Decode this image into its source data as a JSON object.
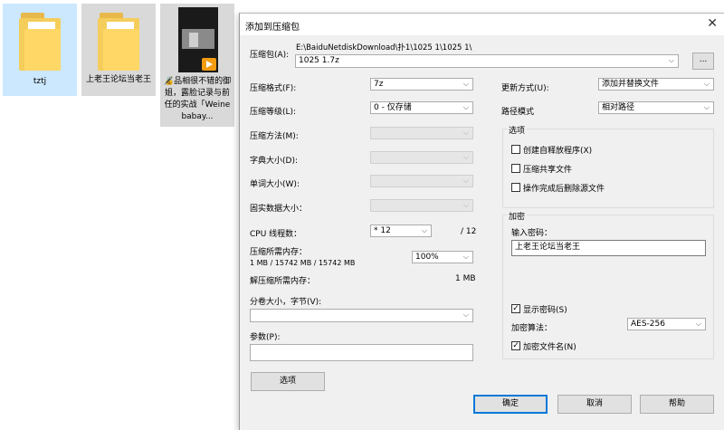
{
  "desktop": {
    "items": [
      {
        "label": "tztj"
      },
      {
        "label": "上老王论坛当老王"
      },
      {
        "label": "🔏品相很不错的御姐，露脸记录与前任的实战「Weine babay..."
      }
    ]
  },
  "dialog": {
    "title": "添加到压缩包",
    "archive_label": "压缩包(A):",
    "archive_path": "E:\\BaiduNetdiskDownload\\扑1\\1025 1\\1025 1\\",
    "archive_name": "1025 1.7z",
    "browse_label": "...",
    "format_label": "压缩格式(F):",
    "format_value": "7z",
    "level_label": "压缩等级(L):",
    "level_value": "0 - 仅存储",
    "method_label": "压缩方法(M):",
    "dict_label": "字典大小(D):",
    "word_label": "单词大小(W):",
    "solid_label": "固实数据大小：",
    "cpu_label": "CPU 线程数：",
    "cpu_value": "* 12",
    "cpu_max": "/ 12",
    "mem_compress_label": "压缩所需内存：",
    "mem_compress_detail": "1 MB / 15742 MB / 15742 MB",
    "mem_percent": "100%",
    "mem_decompress_label": "解压缩所需内存：",
    "mem_decompress_value": "1 MB",
    "split_label": "分卷大小，字节(V):",
    "params_label": "参数(P):",
    "options_button": "选项",
    "update_label": "更新方式(U):",
    "update_value": "添加并替换文件",
    "path_label": "路径模式",
    "path_value": "相对路径",
    "options_group": "选项",
    "opt_sfx": "创建自释放程序(X)",
    "opt_shared": "压缩共享文件",
    "opt_delete": "操作完成后删除源文件",
    "encrypt_group": "加密",
    "password_label": "输入密码：",
    "password_value": "上老王论坛当老王",
    "show_password": "显示密码(S)",
    "enc_method_label": "加密算法：",
    "enc_method_value": "AES-256",
    "encrypt_names": "加密文件名(N)",
    "ok_button": "确定",
    "cancel_button": "取消",
    "help_button": "帮助",
    "close_glyph": "✕",
    "check_mark": "✓",
    "arrow_glyph": "⌵"
  }
}
